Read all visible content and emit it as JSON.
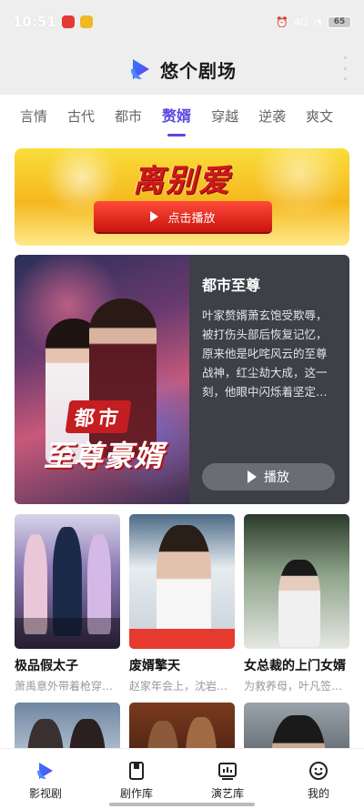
{
  "status_bar": {
    "time": "10:51",
    "network": "4G",
    "battery": "65"
  },
  "header": {
    "app_title": "悠个剧场"
  },
  "tabs": [
    {
      "label": "言情",
      "active": false
    },
    {
      "label": "古代",
      "active": false
    },
    {
      "label": "都市",
      "active": false
    },
    {
      "label": "赘婿",
      "active": true
    },
    {
      "label": "穿越",
      "active": false
    },
    {
      "label": "逆袭",
      "active": false
    },
    {
      "label": "爽文",
      "active": false
    }
  ],
  "banner": {
    "title": "离别爱",
    "button_label": "点击播放"
  },
  "featured": {
    "title": "都市至尊",
    "description": "叶家赘婿萧玄饱受欺辱，被打伤头部后恢复记忆，原来他是叱咤风云的至尊战神，红尘劫大成，这一刻，他眼中闪烁着坚定…",
    "poster_tag": "都市",
    "poster_title": "至尊豪婿",
    "play_label": "播放"
  },
  "dramas": [
    {
      "name": "极品假太子",
      "desc": "萧禹意外带着枪穿越…"
    },
    {
      "name": "废婿擎天",
      "desc": "赵家年会上，沈岩…"
    },
    {
      "name": "女总裁的上门女婿",
      "desc": "为救养母，叶凡签…"
    },
    {
      "name": "",
      "desc": ""
    },
    {
      "name": "",
      "desc": ""
    },
    {
      "name": "",
      "desc": ""
    }
  ],
  "bottom_nav": [
    {
      "label": "影视剧",
      "icon": "play-logo-icon",
      "active": true
    },
    {
      "label": "剧作库",
      "icon": "script-icon",
      "active": false
    },
    {
      "label": "演艺库",
      "icon": "chart-icon",
      "active": false
    },
    {
      "label": "我的",
      "icon": "smile-icon",
      "active": false
    }
  ],
  "colors": {
    "accent": "#5a48e0",
    "banner_red": "#d01818",
    "feature_bg": "#3d4047"
  }
}
